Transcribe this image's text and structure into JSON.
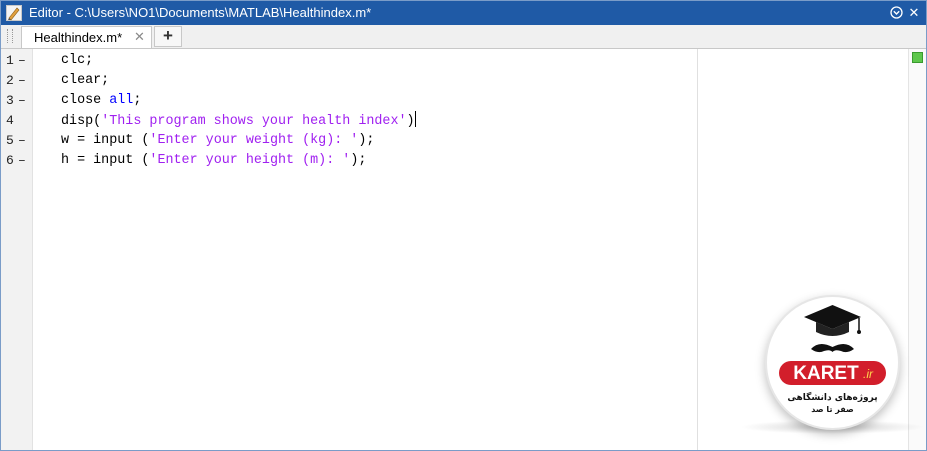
{
  "window": {
    "title": "Editor - C:\\Users\\NO1\\Documents\\MATLAB\\Healthindex.m*",
    "minimize_icon": "chevron-down-circle-icon",
    "close_icon": "close-icon",
    "close_glyph": "✕"
  },
  "tabs": {
    "items": [
      {
        "label": "Healthindex.m*",
        "close_glyph": "✕"
      }
    ],
    "add_glyph": "+"
  },
  "editor": {
    "lines": [
      {
        "number": "1",
        "marker": "–"
      },
      {
        "number": "2",
        "marker": "–"
      },
      {
        "number": "3",
        "marker": "–"
      },
      {
        "number": "4",
        "marker": ""
      },
      {
        "number": "5",
        "marker": "–"
      },
      {
        "number": "6",
        "marker": "–"
      }
    ],
    "code": {
      "l1": "clc;",
      "l2": "clear;",
      "l3_cmd": "close ",
      "l3_kw": "all",
      "l3_end": ";",
      "l4_cmd": "disp(",
      "l4_str": "'This program shows your health index'",
      "l4_end": ")",
      "l5_cmd": "w = input (",
      "l5_str": "'Enter your weight (kg): '",
      "l5_end": ");",
      "l6_cmd": "h = input (",
      "l6_str": "'Enter your height (m): '",
      "l6_end": ");"
    },
    "colors": {
      "keyword": "#0000ff",
      "string": "#a020f0"
    }
  },
  "watermark": {
    "brand": "KARET",
    "domain": ".ir",
    "tagline_1": "پروژه‌های دانشگاهی",
    "tagline_2": "صفر تا صد"
  }
}
